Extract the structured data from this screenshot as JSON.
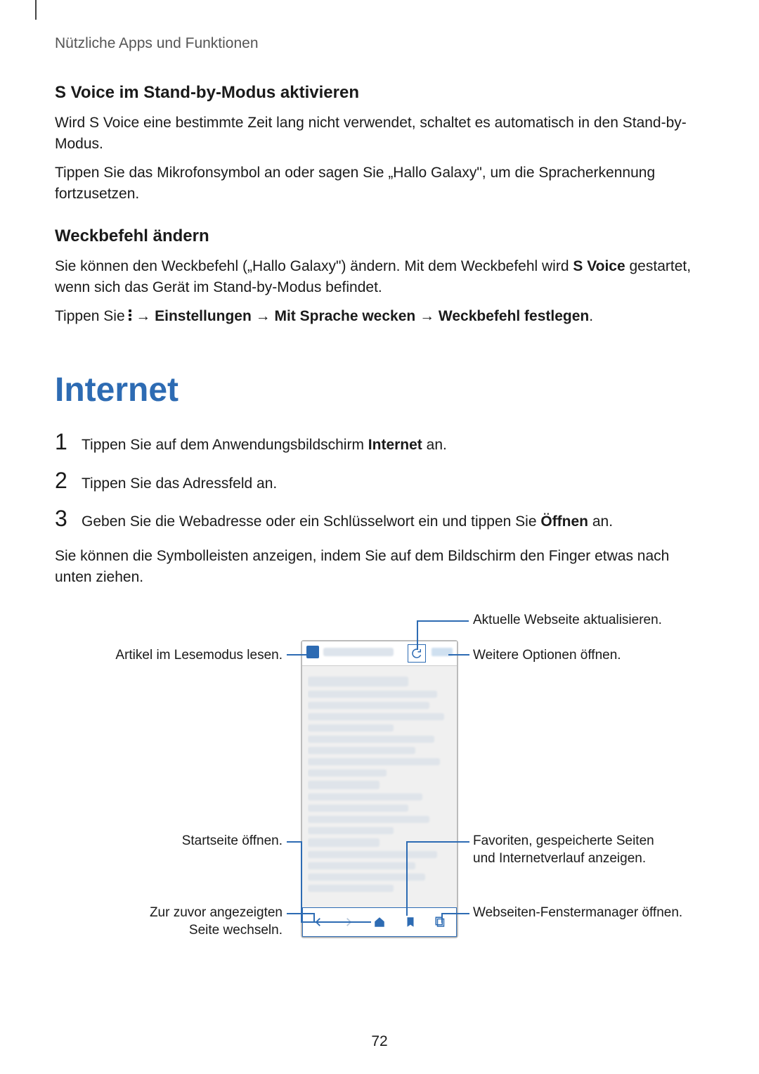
{
  "breadcrumb": "Nützliche Apps und Funktionen",
  "svoice_heading": "S Voice im Stand-by-Modus aktivieren",
  "svoice_p1": "Wird S Voice eine bestimmte Zeit lang nicht verwendet, schaltet es automatisch in den Stand-by-Modus.",
  "svoice_p2": "Tippen Sie das Mikrofonsymbol an oder sagen Sie „Hallo Galaxy\", um die Spracherkennung fortzusetzen.",
  "weck_heading": "Weckbefehl ändern",
  "weck_p1_a": "Sie können den Weckbefehl („Hallo Galaxy\") ändern. Mit dem Weckbefehl wird ",
  "weck_p1_bold": "S Voice",
  "weck_p1_b": " gestartet, wenn sich das Gerät im Stand-by-Modus befindet.",
  "weck_p2_a": "Tippen Sie ",
  "weck_p2_arrow1": " → ",
  "weck_p2_bold1": "Einstellungen",
  "weck_p2_arrow2": " → ",
  "weck_p2_bold2": "Mit Sprache wecken",
  "weck_p2_arrow3": " → ",
  "weck_p2_bold3": "Weckbefehl festlegen",
  "weck_p2_end": ".",
  "internet_heading": "Internet",
  "step1_a": "Tippen Sie auf dem Anwendungsbildschirm ",
  "step1_bold": "Internet",
  "step1_b": " an.",
  "step2": "Tippen Sie das Adressfeld an.",
  "step3_a": "Geben Sie die Webadresse oder ein Schlüsselwort ein und tippen Sie ",
  "step3_bold": "Öffnen",
  "step3_b": " an.",
  "after_list": "Sie können die Symbolleisten anzeigen, indem Sie auf dem Bildschirm den Finger etwas nach unten ziehen.",
  "callouts": {
    "refresh": "Aktuelle Webseite aktualisieren.",
    "readmode": "Artikel im Lesemodus lesen.",
    "more": "Weitere Optionen öffnen.",
    "home": "Startseite öffnen.",
    "bookmarks": "Favoriten, gespeicherte Seiten und Internetverlauf anzeigen.",
    "back": "Zur zuvor angezeigten Seite wechseln.",
    "tabs": "Webseiten-Fenstermanager öffnen."
  },
  "page_number": "72"
}
